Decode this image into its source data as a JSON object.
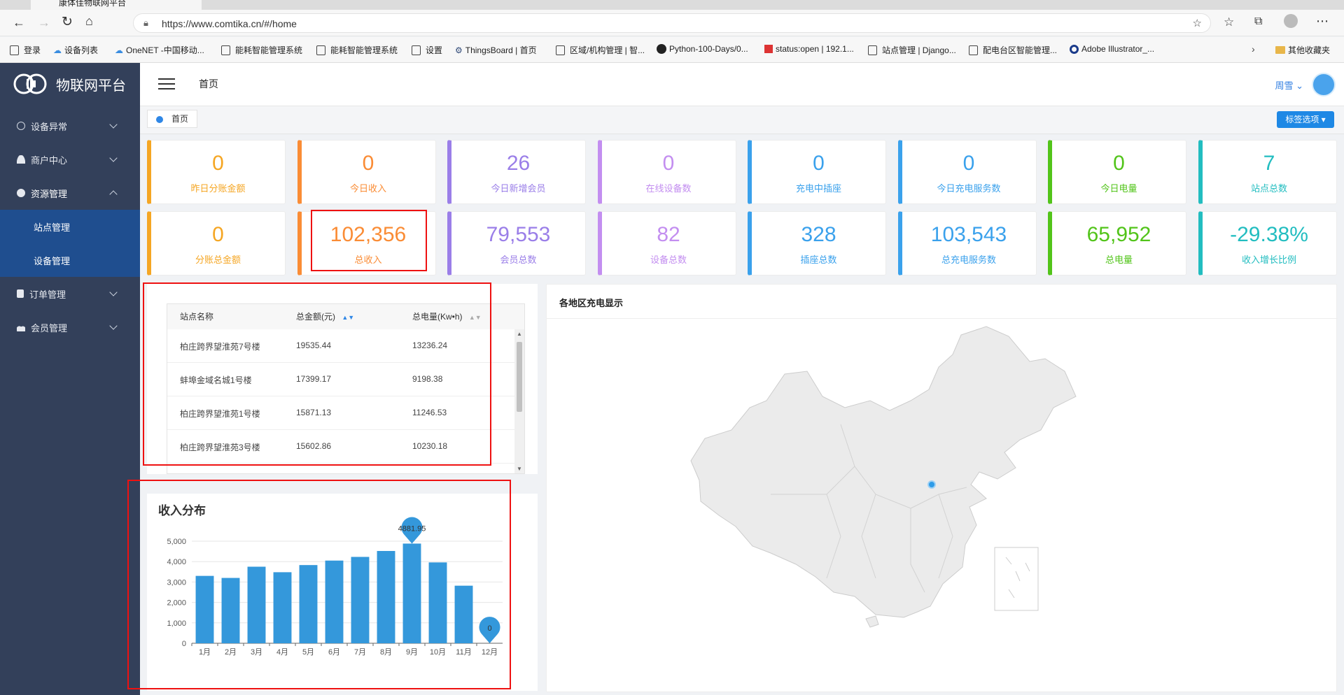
{
  "browser": {
    "tab_title": "康体佳物联网平台",
    "url": "https://www.comtika.cn/#/home",
    "bookmarks": [
      "登录",
      "设备列表",
      "OneNET -中国移动...",
      "能耗智能管理系统",
      "能耗智能管理系统",
      "设置",
      "ThingsBoard | 首页",
      "区域/机构管理 | 智...",
      "Python-100-Days/0...",
      "status:open | 192.1...",
      "站点管理 | Django...",
      "配电台区智能管理...",
      "Adobe Illustrator_...",
      "其他收藏夹"
    ]
  },
  "app": {
    "logo_text": "物联网平台",
    "breadcrumb": "首页",
    "user_name": "周雪 ⌄",
    "tag_home": "首页",
    "tag_options": "标签选项 ▾"
  },
  "sidebar": {
    "items": [
      {
        "label": "设备异常"
      },
      {
        "label": "商户中心"
      },
      {
        "label": "资源管理"
      },
      {
        "label": "站点管理"
      },
      {
        "label": "设备管理"
      },
      {
        "label": "订单管理"
      },
      {
        "label": "会员管理"
      }
    ]
  },
  "colors": {
    "yellow": "#f5a623",
    "orange": "#fa8c35",
    "purple": "#9a7ee8",
    "violet": "#c38ef0",
    "blue": "#3aa1ec",
    "green": "#52c41a",
    "teal": "#22bdc0",
    "bar": "#3498db"
  },
  "cards_row1": [
    {
      "value": "0",
      "label": "昨日分账金额",
      "color": "#f5a623"
    },
    {
      "value": "0",
      "label": "今日收入",
      "color": "#fa8c35"
    },
    {
      "value": "26",
      "label": "今日新增会员",
      "color": "#9a7ee8"
    },
    {
      "value": "0",
      "label": "在线设备数",
      "color": "#c38ef0"
    },
    {
      "value": "0",
      "label": "充电中插座",
      "color": "#3aa1ec"
    },
    {
      "value": "0",
      "label": "今日充电服务数",
      "color": "#3aa1ec"
    },
    {
      "value": "0",
      "label": "今日电量",
      "color": "#52c41a"
    },
    {
      "value": "7",
      "label": "站点总数",
      "color": "#22bdc0"
    }
  ],
  "cards_row2": [
    {
      "value": "0",
      "label": "分账总金额",
      "color": "#f5a623"
    },
    {
      "value": "102,356",
      "label": "总收入",
      "color": "#fa8c35"
    },
    {
      "value": "79,553",
      "label": "会员总数",
      "color": "#9a7ee8"
    },
    {
      "value": "82",
      "label": "设备总数",
      "color": "#c38ef0"
    },
    {
      "value": "328",
      "label": "插座总数",
      "color": "#3aa1ec"
    },
    {
      "value": "103,543",
      "label": "总充电服务数",
      "color": "#3aa1ec"
    },
    {
      "value": "65,952",
      "label": "总电量",
      "color": "#52c41a"
    },
    {
      "value": "-29.38%",
      "label": "收入增长比例",
      "color": "#22bdc0"
    }
  ],
  "station_table": {
    "headers": [
      "站点名称",
      "总金额(元)",
      "总电量(Kw•h)"
    ],
    "rows": [
      [
        "柏庄跨界望淮苑7号楼",
        "19535.44",
        "13236.24"
      ],
      [
        "蚌埠金域名城1号楼",
        "17399.17",
        "9198.38"
      ],
      [
        "柏庄跨界望淮苑1号楼",
        "15871.13",
        "11246.53"
      ],
      [
        "柏庄跨界望淮苑3号楼",
        "15602.86",
        "10230.18"
      ]
    ]
  },
  "map": {
    "title": "各地区充电显示"
  },
  "chart_data": {
    "type": "bar",
    "title": "收入分布",
    "categories": [
      "1月",
      "2月",
      "3月",
      "4月",
      "5月",
      "6月",
      "7月",
      "8月",
      "9月",
      "10月",
      "11月",
      "12月"
    ],
    "values": [
      3300,
      3200,
      3750,
      3480,
      3830,
      4050,
      4230,
      4520,
      4881.95,
      3960,
      2820,
      0
    ],
    "ylim": [
      0,
      5000
    ],
    "yticks": [
      "0",
      "1,000",
      "2,000",
      "3,000",
      "4,000",
      "5,000"
    ],
    "markers": [
      {
        "label": "4881.95",
        "index": 8
      },
      {
        "label": "0",
        "index": 11
      }
    ]
  }
}
